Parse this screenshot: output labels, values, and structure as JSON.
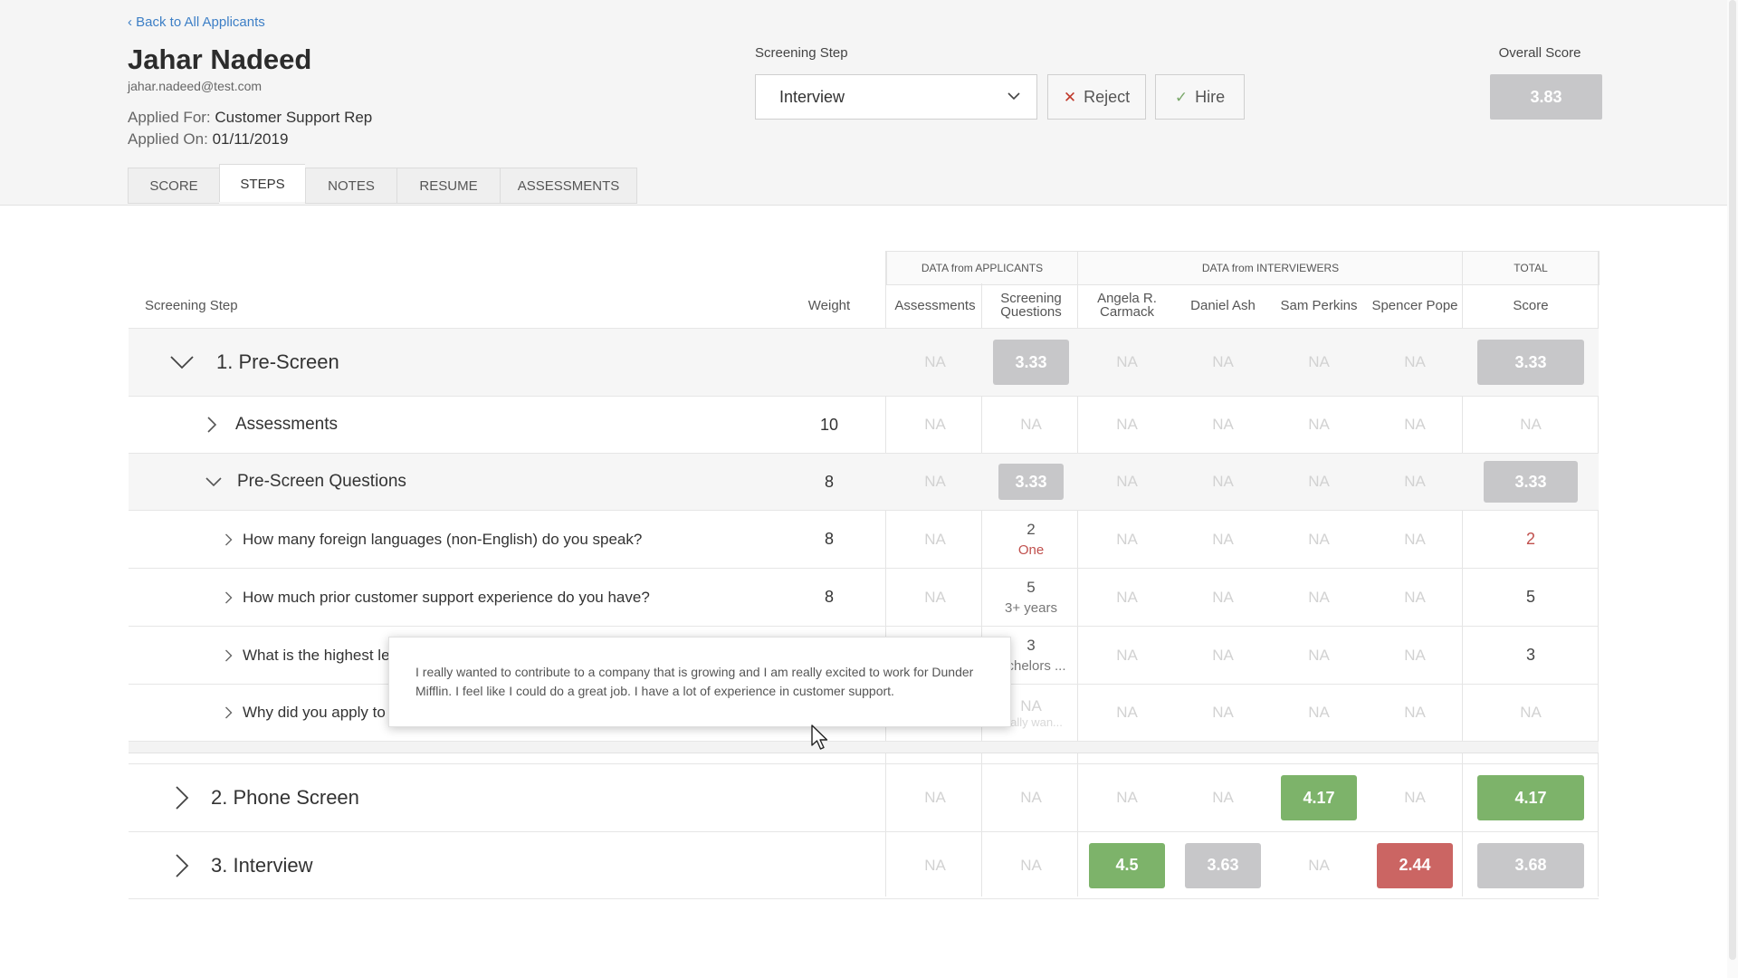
{
  "header": {
    "back_link": "Back to All Applicants",
    "applicant_name": "Jahar Nadeed",
    "email": "jahar.nadeed@test.com",
    "applied_for_label": "Applied For:",
    "applied_for_value": "Customer Support Rep",
    "applied_on_label": "Applied On:",
    "applied_on_value": "01/11/2019",
    "screening_step_label": "Screening Step",
    "screening_step_value": "Interview",
    "reject_label": "Reject",
    "hire_label": "Hire",
    "overall_score_label": "Overall Score",
    "overall_score_value": "3.83"
  },
  "tabs": [
    {
      "label": "SCORE",
      "active": false
    },
    {
      "label": "STEPS",
      "active": true
    },
    {
      "label": "NOTES",
      "active": false
    },
    {
      "label": "RESUME",
      "active": false
    },
    {
      "label": "ASSESSMENTS",
      "active": false
    }
  ],
  "table": {
    "group_headers": {
      "applicants": "DATA from APPLICANTS",
      "interviewers": "DATA from INTERVIEWERS",
      "total": "TOTAL"
    },
    "columns": {
      "step": "Screening Step",
      "weight": "Weight",
      "assessments": "Assessments",
      "screening_questions": "Screening Questions",
      "angela": "Angela R. Carmack",
      "daniel": "Daniel Ash",
      "sam": "Sam Perkins",
      "spencer": "Spencer Pope",
      "score": "Score"
    },
    "na": "NA",
    "rows": {
      "prescreen": {
        "label": "1. Pre-Screen",
        "sq": "3.33",
        "total": "3.33"
      },
      "assessments": {
        "label": "Assessments",
        "weight": "10"
      },
      "psq": {
        "label": "Pre-Screen Questions",
        "weight": "8",
        "sq": "3.33",
        "total": "3.33"
      },
      "q1": {
        "label": "How many foreign languages (non-English) do you speak?",
        "weight": "8",
        "sq_value": "2",
        "sq_answer": "One",
        "total": "2"
      },
      "q2": {
        "label": "How much prior customer support experience do you have?",
        "weight": "8",
        "sq_value": "5",
        "sq_answer": "3+ years",
        "total": "5"
      },
      "q3": {
        "label": "What is the highest le",
        "sq_value": "3",
        "sq_answer": "chelors ...",
        "total": "3"
      },
      "q4": {
        "label": "Why did you apply to",
        "sq_answer": "ally wan...",
        "total": "NA"
      },
      "phone": {
        "label": "2. Phone Screen",
        "sam": "4.17",
        "total": "4.17"
      },
      "interview": {
        "label": "3. Interview",
        "angela": "4.5",
        "daniel": "3.63",
        "spencer": "2.44",
        "total": "3.68"
      }
    }
  },
  "tooltip": {
    "text": "I really wanted to contribute to a company that is growing and I am really excited to work for Dunder Mifflin. I feel like I could do a great job. I have a lot of experience in customer support."
  },
  "colors": {
    "link": "#3d7fc6",
    "score_gray": "#c7c7c9",
    "score_green": "#7db36a",
    "score_red": "#cb6563",
    "reject_icon": "#c0392b",
    "hire_icon": "#7aa86b"
  }
}
